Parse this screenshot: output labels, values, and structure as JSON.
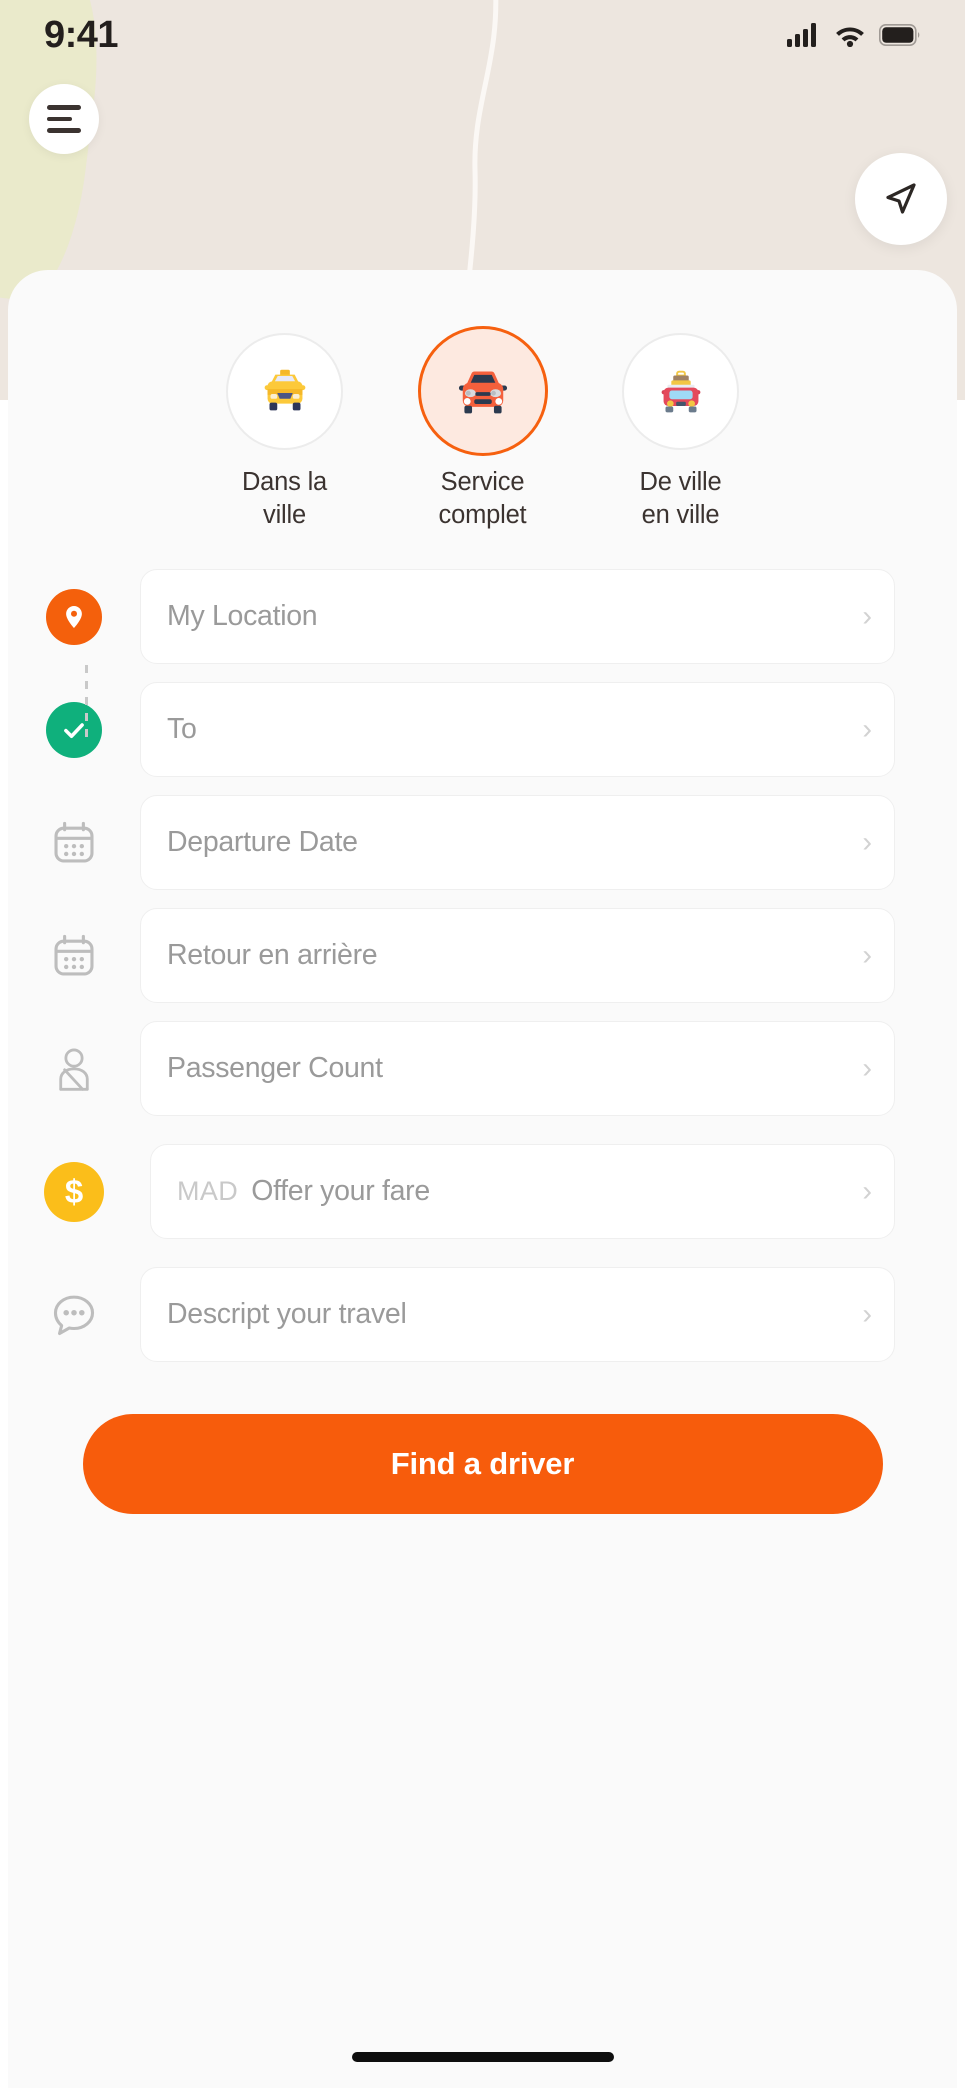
{
  "status_bar": {
    "time": "9:41",
    "icons": [
      "cellular-signal-icon",
      "wifi-icon",
      "battery-icon"
    ]
  },
  "map": {
    "menu_button": "menu-icon",
    "locate_button": "navigation-arrow-icon",
    "background_color": "#EDE6DF"
  },
  "colors": {
    "accent_orange": "#F75C0C",
    "selected_ring": "#F6600F",
    "selected_fill": "#FDE9E0",
    "pin_orange": "#F4600C",
    "check_green": "#0FB07C",
    "money_yellow": "#FBBE1A",
    "sheet_bg": "#FAFAFA",
    "placeholder_gray": "#9A9A9A"
  },
  "vehicle_types": [
    {
      "id": "dans-la-ville",
      "label": "Dans la\nville",
      "label_line1": "Dans la",
      "label_line2": "ville",
      "icon": "taxi-icon",
      "selected": false
    },
    {
      "id": "service-complet",
      "label": "Service\ncomplet",
      "label_line1": "Service",
      "label_line2": "complet",
      "icon": "car-icon",
      "selected": true
    },
    {
      "id": "de-ville-en-ville",
      "label": "De ville\nen ville",
      "label_line1": "De ville",
      "label_line2": "en ville",
      "icon": "car-luggage-icon",
      "selected": false
    }
  ],
  "form_fields": [
    {
      "id": "my-location",
      "placeholder": "My Location",
      "value": "",
      "icon": "location-pin-icon",
      "chevron": "›"
    },
    {
      "id": "to",
      "placeholder": "To",
      "value": "",
      "icon": "check-circle-icon",
      "chevron": "›"
    },
    {
      "id": "departure-date",
      "placeholder": "Departure Date",
      "value": "",
      "icon": "calendar-icon",
      "chevron": "›"
    },
    {
      "id": "return-date",
      "placeholder": "Retour en arrière",
      "value": "",
      "icon": "calendar-icon",
      "chevron": "›"
    },
    {
      "id": "passenger-count",
      "placeholder": "Passenger Count",
      "value": "",
      "icon": "passenger-icon",
      "chevron": "›"
    },
    {
      "id": "offer-fare",
      "placeholder": "Offer your fare",
      "value": "",
      "currency": "MAD",
      "icon": "dollar-circle-icon",
      "chevron": "›"
    },
    {
      "id": "describe-travel",
      "placeholder": "Descript your travel",
      "value": "",
      "icon": "chat-bubble-icon",
      "chevron": "›"
    }
  ],
  "cta": {
    "label": "Find a driver"
  }
}
